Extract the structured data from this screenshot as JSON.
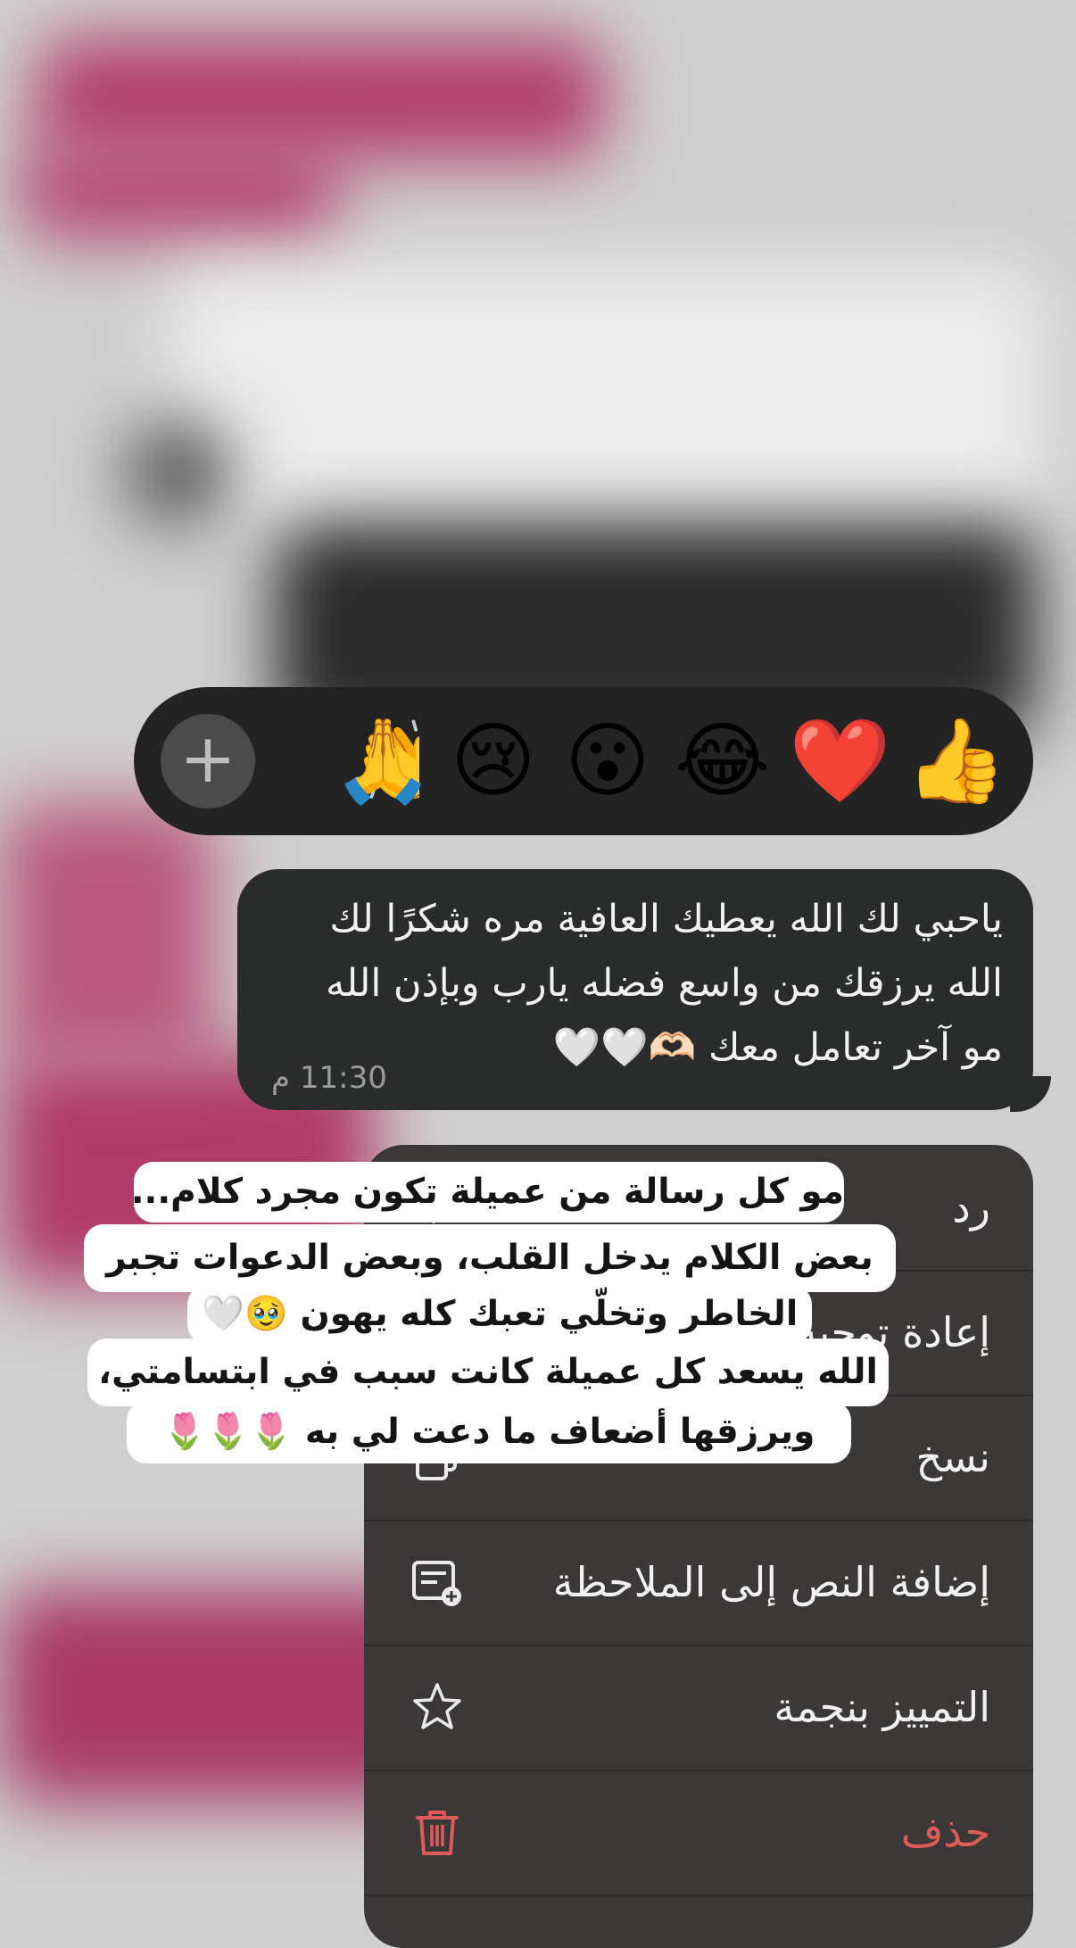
{
  "reactions": {
    "emojis": [
      "👍",
      "❤️",
      "😂",
      "😮",
      "😢",
      "🙏",
      "👏"
    ],
    "add_button": "+"
  },
  "message": {
    "text": "ياحبي لك الله يعطيك العافية مره شكرًا لك\nالله يرزقك من واسع فضله يارب وبإذن الله\nمو آخر تعامل معك 🫶🏻🤍🤍",
    "time": "11:30 م"
  },
  "menu": {
    "items": [
      {
        "label": "رد",
        "icon": "reply-icon"
      },
      {
        "label": "إعادة توجيه",
        "icon": "forward-icon"
      },
      {
        "label": "نسخ",
        "icon": "copy-icon"
      },
      {
        "label": "إضافة النص إلى الملاحظة",
        "icon": "add-note-icon"
      },
      {
        "label": "التمييز بنجمة",
        "icon": "star-icon"
      },
      {
        "label": "حذف",
        "icon": "trash-icon"
      }
    ],
    "danger_color": "#e05a5a"
  },
  "caption": {
    "lines": [
      "مو كل رسالة من عميلة تكون مجرد كلام...",
      "بعض الكلام يدخل القلب، وبعض الدعوات تجبر",
      "الخاطر وتخلّي تعبك كله يهون 🥹🤍",
      "الله يسعد كل عميلة كانت سبب في ابتسامتي،",
      "ويرزقها أضعاف ما دعت لي به 🌷🌷🌷"
    ]
  }
}
